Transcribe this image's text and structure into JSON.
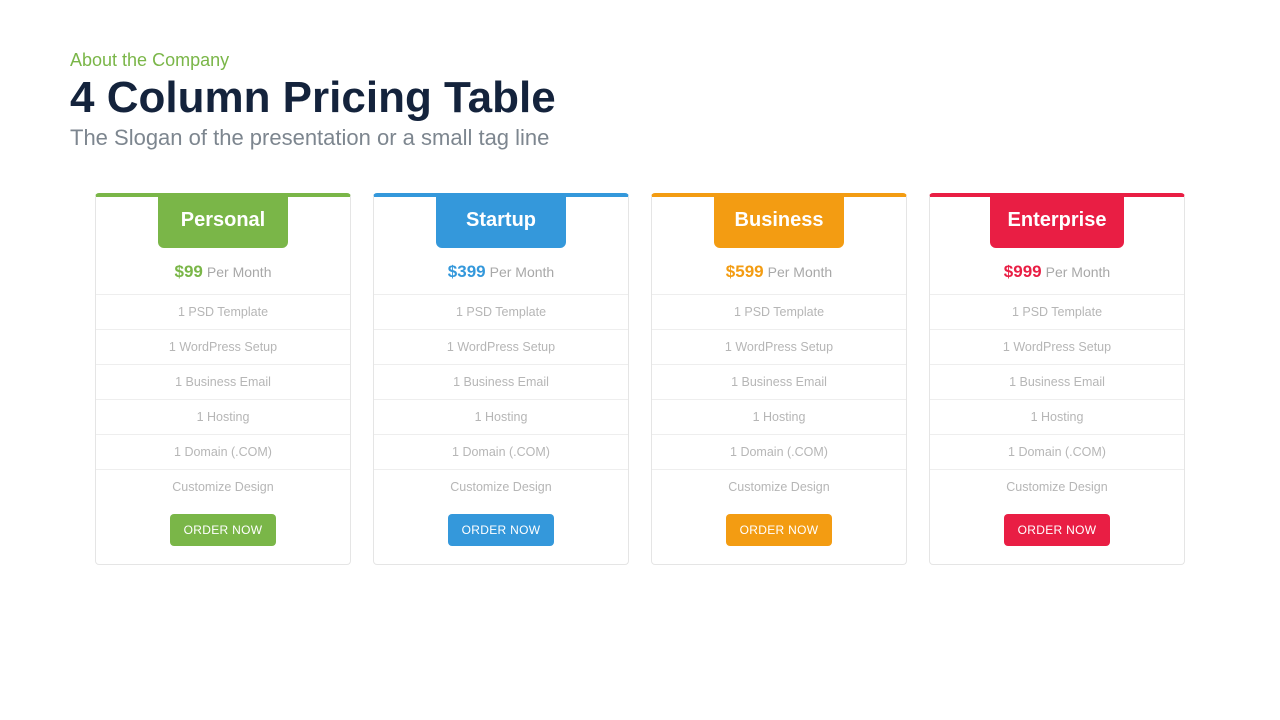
{
  "header": {
    "kicker": "About the Company",
    "title": "4 Column Pricing Table",
    "subtitle": "The Slogan of the presentation or a small tag line"
  },
  "common": {
    "per_label": "Per Month",
    "order_label": "ORDER NOW",
    "features": [
      "1 PSD Template",
      "1 WordPress Setup",
      "1 Business Email",
      "1 Hosting",
      "1 Domain (.COM)",
      "Customize Design"
    ]
  },
  "plans": [
    {
      "name": "Personal",
      "price": "$99",
      "color": "#7ab648"
    },
    {
      "name": "Startup",
      "price": "$399",
      "color": "#3498db"
    },
    {
      "name": "Business",
      "price": "$599",
      "color": "#f39c12"
    },
    {
      "name": "Enterprise",
      "price": "$999",
      "color": "#e91e44"
    }
  ]
}
